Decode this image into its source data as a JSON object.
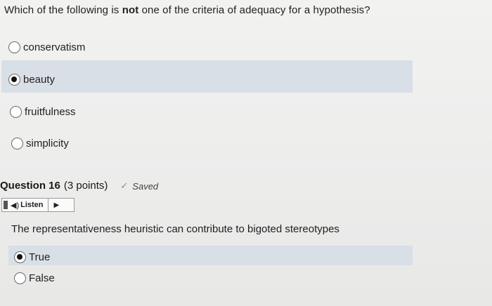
{
  "question15": {
    "prompt_before": "Which of the following is ",
    "prompt_emphasis": "not",
    "prompt_after": " one of the criteria of adequacy for a hypothesis?",
    "options": [
      {
        "label": "conservatism",
        "selected": false
      },
      {
        "label": "beauty",
        "selected": true
      },
      {
        "label": "fruitfulness",
        "selected": false
      },
      {
        "label": "simplicity",
        "selected": false
      }
    ]
  },
  "question16": {
    "title": "Question 16",
    "points": "(3 points)",
    "saved_label": "Saved",
    "listen_label": "Listen",
    "prompt": "The representativeness heuristic can contribute to bigoted stereotypes",
    "options": [
      {
        "label": "True",
        "selected": true
      },
      {
        "label": "False",
        "selected": false
      }
    ]
  },
  "icons": {
    "check": "check-icon",
    "speaker": "speaker-icon",
    "play": "play-icon"
  },
  "colors": {
    "selected_highlight": "#d9dfe7",
    "background": "#ececeb"
  }
}
